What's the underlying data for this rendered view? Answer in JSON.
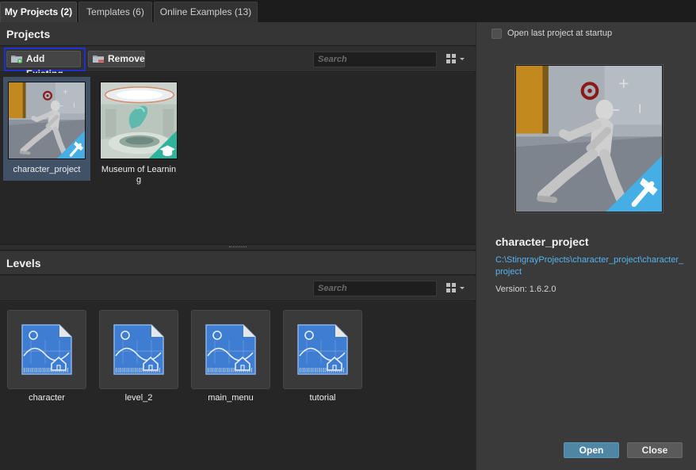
{
  "tabs": [
    {
      "label": "My Projects (2)",
      "active": true
    },
    {
      "label": "Templates (6)",
      "active": false
    },
    {
      "label": "Online Examples (13)",
      "active": false
    }
  ],
  "projects_section": {
    "title": "Projects",
    "add_label": "Add Existing",
    "remove_label": "Remove",
    "search_placeholder": "Search",
    "items": [
      {
        "name": "character_project",
        "badge": "hammer-icon",
        "selected": true
      },
      {
        "name": "Museum of Learning",
        "badge": "graduation-cap-icon",
        "selected": false
      }
    ]
  },
  "levels_section": {
    "title": "Levels",
    "search_placeholder": "Search",
    "items": [
      {
        "name": "character"
      },
      {
        "name": "level_2"
      },
      {
        "name": "main_menu"
      },
      {
        "name": "tutorial"
      }
    ]
  },
  "details": {
    "open_last_label": "Open last project at startup",
    "project_name": "character_project",
    "path": "C:\\StingrayProjects\\character_project\\character_project",
    "version": "Version: 1.6.2.0",
    "open_label": "Open",
    "close_label": "Close"
  },
  "colors": {
    "accent_blue": "#4aa8e0",
    "teal_badge": "#2fb39b",
    "selection": "#415266",
    "link": "#55b4f0"
  }
}
